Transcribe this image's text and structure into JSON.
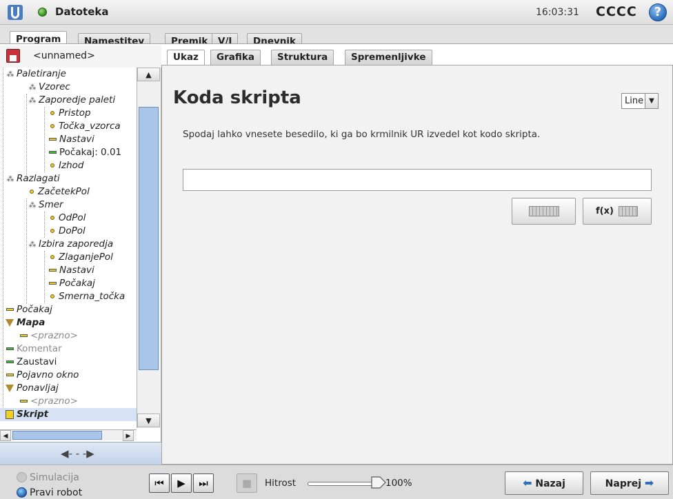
{
  "titlebar": {
    "file_label": "Datoteka",
    "time": "16:03:31",
    "robot_name": "CCCC",
    "help_glyph": "?"
  },
  "main_tabs": [
    "Program",
    "Namestitev",
    "Premik",
    "V/I",
    "Dnevnik"
  ],
  "program": {
    "name": "<unnamed>"
  },
  "tree": [
    {
      "label": "Paletiranje",
      "icon": "group"
    },
    {
      "label": "Vzorec",
      "icon": "group"
    },
    {
      "label": "Zaporedje paleti",
      "icon": "group"
    },
    {
      "label": "Pristop",
      "icon": "waypoint"
    },
    {
      "label": "Točka_vzorca",
      "icon": "waypoint"
    },
    {
      "label": "Nastavi",
      "icon": "bar-yellow"
    },
    {
      "label": "Počakaj: 0.01",
      "icon": "bar-green"
    },
    {
      "label": "Izhod",
      "icon": "waypoint"
    },
    {
      "label": "Razlagati",
      "icon": "group"
    },
    {
      "label": "ZačetekPol",
      "icon": "waypoint"
    },
    {
      "label": "Smer",
      "icon": "group"
    },
    {
      "label": "OdPol",
      "icon": "waypoint"
    },
    {
      "label": "DoPol",
      "icon": "waypoint"
    },
    {
      "label": "Izbira zaporedja",
      "icon": "group"
    },
    {
      "label": "ZlaganjePol",
      "icon": "waypoint"
    },
    {
      "label": "Nastavi",
      "icon": "bar-yellow"
    },
    {
      "label": "Počakaj",
      "icon": "bar-yellow"
    },
    {
      "label": "Smerna_točka",
      "icon": "waypoint"
    },
    {
      "label": "Počakaj",
      "icon": "bar-yellow"
    },
    {
      "label": "Mapa",
      "icon": "folder-triangle"
    },
    {
      "label": "<prazno>",
      "icon": "bar-yellow"
    },
    {
      "label": "Komentar",
      "icon": "bar-green"
    },
    {
      "label": "Zaustavi",
      "icon": "bar-green"
    },
    {
      "label": "Pojavno okno",
      "icon": "bar-yellow"
    },
    {
      "label": "Ponavljaj",
      "icon": "folder-triangle"
    },
    {
      "label": "<prazno>",
      "icon": "bar-yellow"
    },
    {
      "label": "Skript",
      "icon": "script"
    }
  ],
  "sub_tabs": [
    "Ukaz",
    "Grafika",
    "Struktura",
    "Spremenljivke"
  ],
  "command": {
    "title": "Koda skripta",
    "mode_select": "Line",
    "description": "Spodaj lahko vnesete besedilo, ki ga bo krmilnik UR izvedel kot kodo skripta.",
    "script_value": "",
    "fx_label": "f(x)"
  },
  "footer": {
    "simulation_label": "Simulacija",
    "real_robot_label": "Pravi robot",
    "speed_label": "Hitrost",
    "speed_value": "100%",
    "speed_fraction": 1.0,
    "back_label": "Nazaj",
    "next_label": "Naprej"
  }
}
